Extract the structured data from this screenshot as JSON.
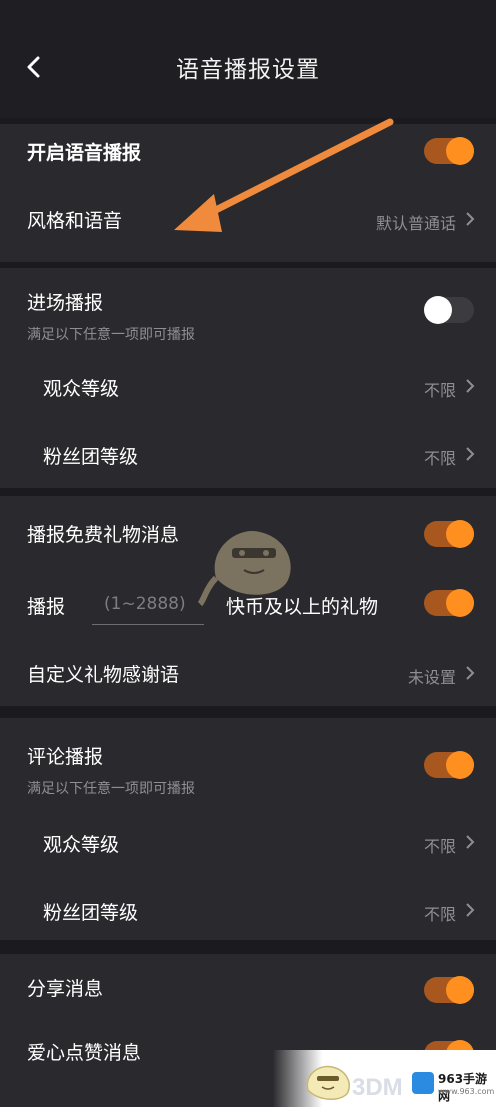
{
  "header": {
    "title": "语音播报设置"
  },
  "section1": {
    "enable_label": "开启语音播报",
    "style_label": "风格和语音",
    "style_value": "默认普通话"
  },
  "section2": {
    "entry_label": "进场播报",
    "entry_sub": "满足以下任意一项即可播报",
    "audience_label": "观众等级",
    "audience_value": "不限",
    "fan_label": "粉丝团等级",
    "fan_value": "不限"
  },
  "section3": {
    "free_gift_label": "播报免费礼物消息",
    "gift_prefix": "播报",
    "gift_placeholder": "(1~2888)",
    "gift_suffix": "快币及以上的礼物",
    "thanks_label": "自定义礼物感谢语",
    "thanks_value": "未设置"
  },
  "section4": {
    "comment_label": "评论播报",
    "comment_sub": "满足以下任意一项即可播报",
    "audience_label": "观众等级",
    "audience_value": "不限",
    "fan_label": "粉丝团等级",
    "fan_value": "不限"
  },
  "section5": {
    "share_label": "分享消息",
    "partial_label": "爱心点赞消息"
  },
  "toggles": {
    "enable": true,
    "entry": false,
    "free_gift": true,
    "gift_threshold": true,
    "comment": true,
    "share": true
  },
  "watermark": {
    "brand_3dm": "3DM",
    "site_name": "963手游网",
    "site_url": "www.963.com"
  },
  "colors": {
    "accent": "#ff8f1f",
    "track_on": "#a8571f",
    "background": "#1b1b1f",
    "section": "#2a2a2e"
  }
}
